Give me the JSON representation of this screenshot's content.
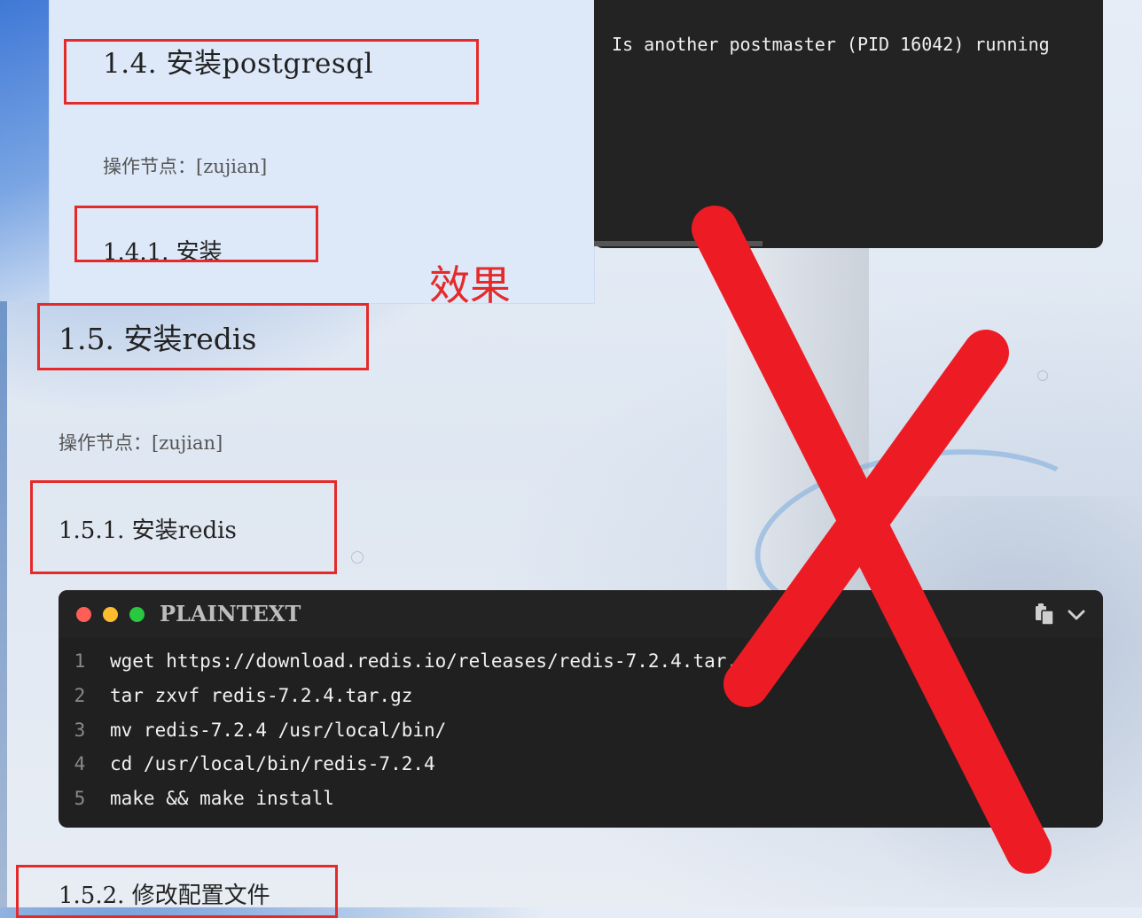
{
  "doc_top": {
    "heading": "1.4.  安装postgresql",
    "operation_node": "操作节点：[zujian]",
    "sub_heading": "1.4.1.  安装"
  },
  "annotation": {
    "effect_label": "效果",
    "color": "#e52a2a"
  },
  "terminal": {
    "line": "Is another postmaster (PID 16042) running"
  },
  "doc_main": {
    "heading": "1.5.  安装redis",
    "operation_node": "操作节点：[zujian]",
    "sub_heading": "1.5.1.  安装redis",
    "next_heading": "1.5.2.  修改配置文件"
  },
  "code_block": {
    "language": "PLAINTEXT",
    "lines": [
      {
        "num": "1",
        "text": "wget https://download.redis.io/releases/redis-7.2.4.tar.gz"
      },
      {
        "num": "2",
        "text": "tar zxvf redis-7.2.4.tar.gz"
      },
      {
        "num": "3",
        "text": "mv redis-7.2.4 /usr/local/bin/"
      },
      {
        "num": "4",
        "text": "cd /usr/local/bin/redis-7.2.4"
      },
      {
        "num": "5",
        "text": "make && make install"
      }
    ],
    "icons": [
      "copy-icon",
      "chevron-down-icon"
    ],
    "window_dots": [
      "#fd5f57",
      "#febc2e",
      "#28c840"
    ]
  }
}
